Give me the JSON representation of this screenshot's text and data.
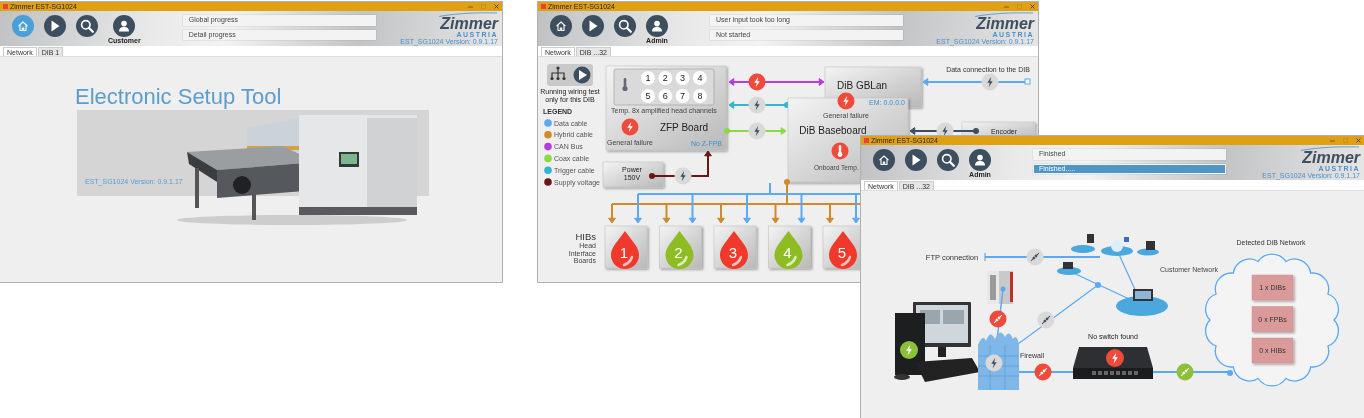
{
  "windows": [
    {
      "title": "Zimmer EST-SG1024",
      "nav": [
        {
          "kind": "home",
          "selected": true
        },
        {
          "kind": "play",
          "selected": false
        },
        {
          "kind": "search",
          "selected": false
        },
        {
          "kind": "user",
          "selected": false
        }
      ],
      "user": "Customer",
      "progress": [
        {
          "text": "Global progress"
        },
        {
          "text": "Detail progress"
        }
      ],
      "logo": {
        "brand": "Zimmer",
        "country": "AUSTRIA",
        "version": "EST_SG1024 Version: 0.9.1.17"
      },
      "tabs": [
        {
          "label": "Network",
          "selected": true
        },
        {
          "label": "DIB 1",
          "selected": false
        }
      ],
      "content": {
        "kind": "welcome",
        "heading": "Electronic Setup Tool",
        "version": "EST_SG1024 Version: 0.9.1.17"
      }
    },
    {
      "title": "Zimmer EST-SG1024",
      "nav": [
        {
          "kind": "home",
          "selected": false
        },
        {
          "kind": "play",
          "selected": false
        },
        {
          "kind": "search",
          "selected": false
        },
        {
          "kind": "user",
          "selected": false
        }
      ],
      "user": "Admin",
      "progress": [
        {
          "text": "User input took too long"
        },
        {
          "text": "Not started"
        }
      ],
      "logo": {
        "brand": "Zimmer",
        "country": "AUSTRIA",
        "version": "EST_SG1024 Version: 0.9.1.17"
      },
      "tabs": [
        {
          "label": "Network",
          "selected": true
        },
        {
          "label": "DIB ...32",
          "selected": false
        }
      ],
      "content": {
        "kind": "wiring",
        "test_caption": [
          "Running wiring test",
          "only for this DIB"
        ],
        "legend_title": "LEGEND",
        "legend": [
          {
            "label": "Data cable",
            "color": "#59a9f5"
          },
          {
            "label": "Hybrid cable",
            "color": "#d08a2a"
          },
          {
            "label": "CAN Bus",
            "color": "#b43de0"
          },
          {
            "label": "Coax cable",
            "color": "#8ada44"
          },
          {
            "label": "Trigger cable",
            "color": "#2eb6d2"
          },
          {
            "label": "Supply voltage",
            "color": "#6b1515"
          }
        ],
        "zfp": {
          "title": "ZFP Board",
          "channels": [
            "1",
            "2",
            "3",
            "4",
            "5",
            "6",
            "7",
            "8"
          ],
          "caption": "Temp. 8x amplified head channels",
          "failure": {
            "label": "General failure",
            "fault": true
          },
          "status": "No Z-FPB"
        },
        "power": {
          "label": [
            "Power",
            "150V"
          ],
          "fault": false
        },
        "links": [
          {
            "color": "#b43de0",
            "fault": true
          },
          {
            "color": "#2eb6d2",
            "fault": false
          },
          {
            "color": "#8ada44",
            "fault": false
          }
        ],
        "gblan": {
          "title": "DiB GBLan"
        },
        "baseboard": {
          "title": "DiB Baseboard",
          "failure": {
            "label": "General failure",
            "fault": true
          },
          "temperature": {
            "label": "Onboard Temp.",
            "fault": true
          },
          "version": "EM: 0.0.0.0"
        },
        "data_connection": {
          "label": "Data connection to the DIB",
          "fault": false
        },
        "encoder": {
          "label": "Encoder",
          "fault": false
        },
        "hibs_title": "HIBs",
        "hibs_caption": [
          "Head",
          "Interface",
          "Boards"
        ],
        "hibs": [
          {
            "number": "1",
            "fault": true
          },
          {
            "number": "2",
            "fault": false
          },
          {
            "number": "3",
            "fault": true
          },
          {
            "number": "4",
            "fault": false
          },
          {
            "number": "5",
            "fault": true
          }
        ]
      }
    },
    {
      "title": "Zimmer EST-SG1024",
      "nav": [
        {
          "kind": "home",
          "selected": false
        },
        {
          "kind": "play",
          "selected": false
        },
        {
          "kind": "search",
          "selected": false
        },
        {
          "kind": "user",
          "selected": false
        }
      ],
      "user": "Admin",
      "progress": [
        {
          "text": "Finished"
        },
        {
          "text": "Finished.....",
          "level": 1
        }
      ],
      "logo": {
        "brand": "Zimmer",
        "country": "AUSTRIA",
        "version": "EST_SG1024 Version: 0.9.1.17"
      },
      "tabs": [
        {
          "label": "Network",
          "selected": true
        },
        {
          "label": "DIB ...32",
          "selected": false
        }
      ],
      "content": {
        "kind": "network",
        "ftp": {
          "label": "FTP connection",
          "fault": false,
          "connected": false
        },
        "customer_network": "Customer Network",
        "server_link": {
          "fault": true
        },
        "uplink": {
          "fault": false,
          "connected": false
        },
        "pc": {
          "connected": true
        },
        "firewall": {
          "label": "Firewall",
          "fault": false,
          "connected": false
        },
        "firewall_link": {
          "fault": true
        },
        "switch": {
          "label": "No switch found",
          "fault": true
        },
        "dib_link": {
          "connected": true
        },
        "detected": {
          "title": "Detected DiB Network",
          "counts": [
            "1 x DIBs",
            "0 x FPBs",
            "0 x HIBs"
          ]
        }
      }
    }
  ]
}
